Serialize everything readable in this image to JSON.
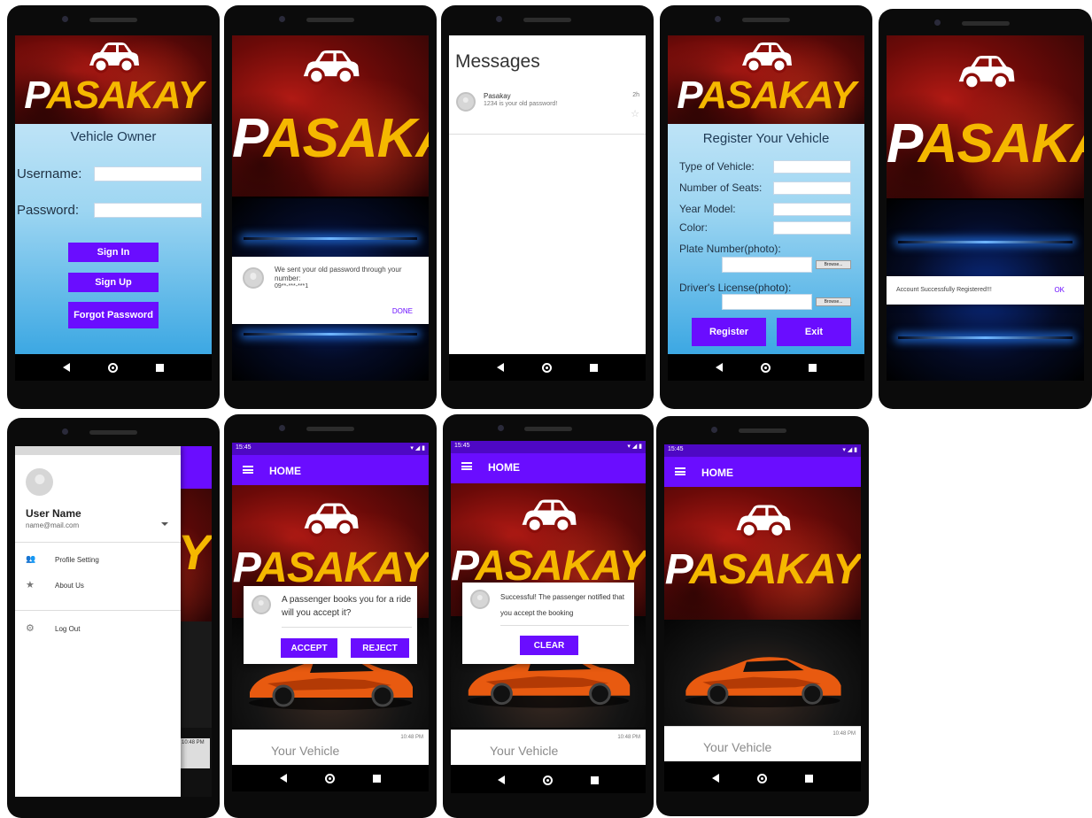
{
  "brand": {
    "first_letter": "P",
    "rest": "ASAKAY"
  },
  "colors": {
    "accent": "#6a0dff",
    "brand_yellow": "#f5b800",
    "banner_red": "#8b0e0a"
  },
  "login": {
    "title": "Vehicle Owner",
    "username_label": "Username:",
    "password_label": "Password:",
    "sign_in": "Sign In",
    "sign_up": "Sign Up",
    "forgot": "Forgot Password"
  },
  "forgot_dialog": {
    "message": "We sent your old password through your number:",
    "number": "09**-***-***1",
    "done": "DONE"
  },
  "messages": {
    "title": "Messages",
    "sender": "Pasakay",
    "preview": "1234 is your old password!",
    "time": "2h"
  },
  "register": {
    "title": "Register Your Vehicle",
    "type_label": "Type of Vehicle:",
    "seats_label": "Number of Seats:",
    "year_label": "Year Model:",
    "color_label": "Color:",
    "plate_label": "Plate Number(photo):",
    "license_label": "Driver's License(photo):",
    "browse": "Browse...",
    "register_btn": "Register",
    "exit_btn": "Exit"
  },
  "registered_dialog": {
    "message": "Account Successfully Registered!!!",
    "ok": "OK"
  },
  "drawer": {
    "user_name": "User Name",
    "email": "name@mail.com",
    "items": [
      "Profile Setting",
      "About Us",
      "Log Out"
    ],
    "bg_time": "10:48 PM"
  },
  "home": {
    "status_time": "15:45",
    "title": "HOME",
    "vehicle_label": "Your Vehicle",
    "vehicle_time": "10:48 PM"
  },
  "booking_dialog": {
    "message": "A passenger books you for a ride will you accept it?",
    "accept": "ACCEPT",
    "reject": "REJECT"
  },
  "success_dialog": {
    "message": "Successful! The passenger notified that you accept the booking",
    "clear": "CLEAR"
  }
}
